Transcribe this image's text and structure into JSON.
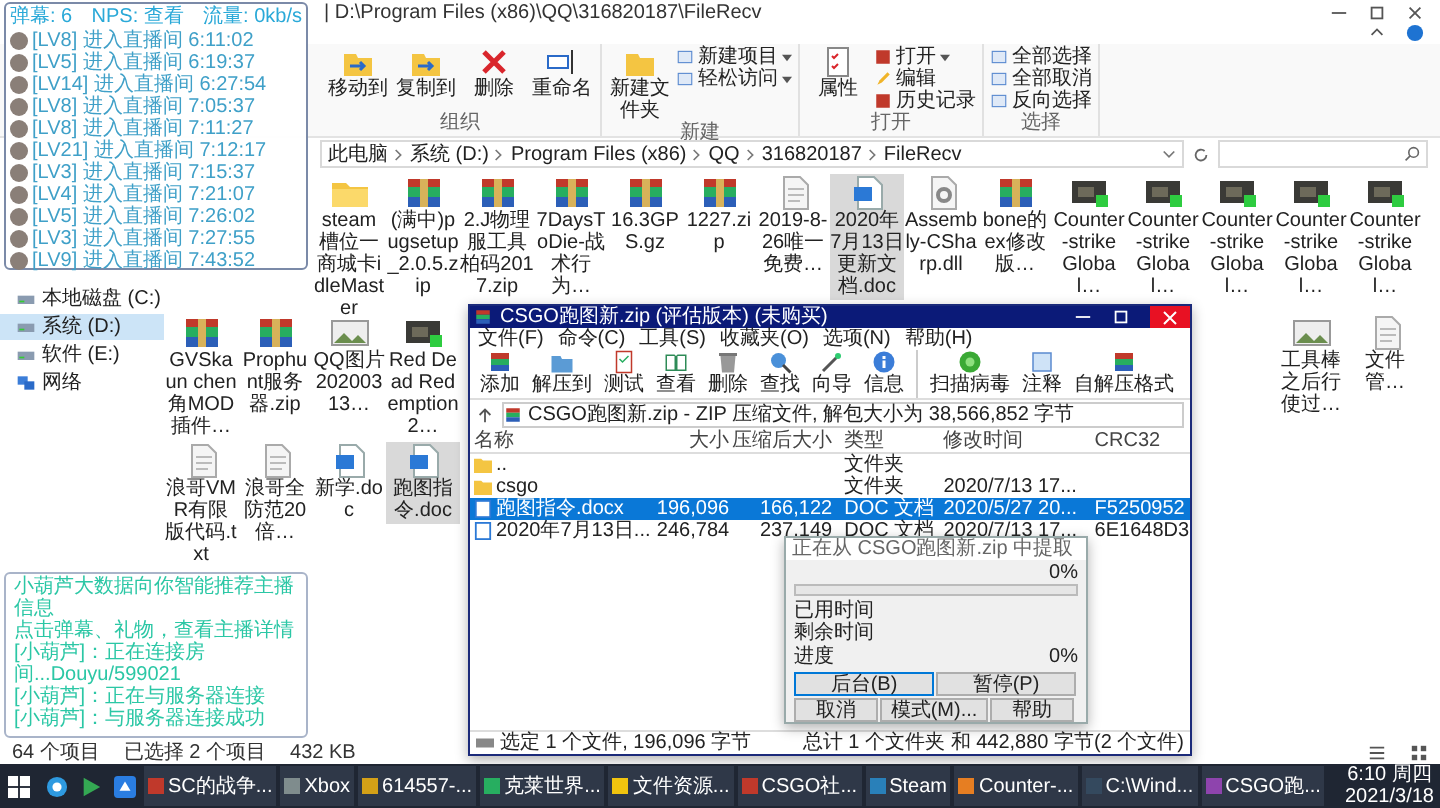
{
  "explorer": {
    "title": "| D:\\Program Files (x86)\\QQ\\316820187\\FileRecv",
    "ribbon_groups": [
      {
        "label": "组织",
        "large": [
          {
            "label": "移动到"
          },
          {
            "label": "复制到"
          },
          {
            "label": "删除"
          },
          {
            "label": "重命名"
          }
        ]
      },
      {
        "label": "新建",
        "large": [
          {
            "label": "新建文件夹"
          }
        ],
        "small": [
          {
            "label": "新建项目",
            "dropdown": true
          },
          {
            "label": "轻松访问",
            "dropdown": true
          }
        ]
      },
      {
        "label": "打开",
        "large": [
          {
            "label": "属性"
          }
        ],
        "small": [
          {
            "label": "打开",
            "dropdown": true
          },
          {
            "label": "编辑",
            "dropdown": false
          },
          {
            "label": "历史记录",
            "dropdown": false
          }
        ]
      },
      {
        "label": "选择",
        "small": [
          {
            "label": "全部选择",
            "dropdown": false
          },
          {
            "label": "全部取消",
            "dropdown": false
          },
          {
            "label": "反向选择",
            "dropdown": false
          }
        ]
      }
    ],
    "breadcrumb": [
      "此电脑",
      "系统 (D:)",
      "Program Files (x86)",
      "QQ",
      "316820187",
      "FileRecv"
    ],
    "nav_items": [
      {
        "label": "本地磁盘 (C:)",
        "kind": "drive",
        "selected": false
      },
      {
        "label": "系统 (D:)",
        "kind": "drive",
        "selected": true
      },
      {
        "label": "软件 (E:)",
        "kind": "drive",
        "selected": false
      },
      {
        "label": "网络",
        "kind": "network",
        "selected": false
      }
    ],
    "file_rows": [
      {
        "left": [
          {
            "name": "steam槽位一商城卡idleMaster",
            "kind": "folder",
            "selected": false
          },
          {
            "name": "(满中)pugsetup_2.0.5.zip",
            "kind": "archive",
            "selected": false
          },
          {
            "name": "2.J物理服工具柏码2017.zip",
            "kind": "archive",
            "selected": false
          },
          {
            "name": "7DaysToDie-战术行为…",
            "kind": "archive",
            "selected": false
          },
          {
            "name": "16.3GPS.gz",
            "kind": "archive",
            "selected": false
          },
          {
            "name": "1227.zip",
            "kind": "archive",
            "selected": false
          },
          {
            "name": "2019-8-26唯一免费…",
            "kind": "text",
            "selected": false
          },
          {
            "name": "2020年7月13日更新文档.doc",
            "kind": "doc",
            "selected": true
          },
          {
            "name": "Assembly-CSharp.dll",
            "kind": "dll",
            "selected": false
          },
          {
            "name": "bone的ex修改版…",
            "kind": "archive",
            "selected": false
          },
          {
            "name": "Counter-strike Global…",
            "kind": "video",
            "selected": false
          },
          {
            "name": "Counter-strike Global…",
            "kind": "video",
            "selected": false
          },
          {
            "name": "Counter-strike Global…",
            "kind": "video",
            "selected": false
          },
          {
            "name": "Counter-strike Global…",
            "kind": "video",
            "selected": false
          },
          {
            "name": "Counter-strike Global…",
            "kind": "video",
            "selected": false
          }
        ]
      },
      {
        "left": [
          {
            "name": "GVSkaun chen角MOD插件…",
            "kind": "archive",
            "selected": false
          },
          {
            "name": "Prophunt服务器.zip",
            "kind": "archive",
            "selected": false
          },
          {
            "name": "QQ图片20200313…",
            "kind": "image",
            "selected": false
          },
          {
            "name": "Red Dead Redemption 2…",
            "kind": "video",
            "selected": false
          }
        ],
        "right": [
          {
            "name": "工具棒之后行使过…",
            "kind": "image",
            "selected": false
          },
          {
            "name": "文件管…",
            "kind": "text",
            "selected": false
          }
        ]
      },
      {
        "left": [
          {
            "name": "浪哥VMR有限版代码.txt",
            "kind": "text",
            "selected": false
          },
          {
            "name": "浪哥全防范20倍…",
            "kind": "text",
            "selected": false
          },
          {
            "name": "新学.doc",
            "kind": "doc",
            "selected": false
          },
          {
            "name": "跑图指令.doc",
            "kind": "doc",
            "selected": true
          }
        ]
      }
    ],
    "status": [
      "64 个项目",
      "已选择 2 个项目",
      "432 KB"
    ]
  },
  "overlay": {
    "stats": [
      "弹幕: 6",
      "NPS: 查看",
      "流量: 0kb/s"
    ],
    "chat": [
      "[LV8] 进入直播间 6:11:02",
      "[LV5] 进入直播间 6:19:37",
      "[LV14] 进入直播间 6:27:54",
      "[LV8] 进入直播间 7:05:37",
      "[LV8] 进入直播间 7:11:27",
      "[LV21] 进入直播间 7:12:17",
      "[LV3] 进入直播间 7:15:37",
      "[LV4] 进入直播间 7:21:07",
      "[LV5] 进入直播间 7:26:02",
      "[LV3] 进入直播间 7:27:55",
      "[LV9] 进入直播间 7:43:52"
    ],
    "messages": [
      "小葫芦大数据向你智能推荐主播信息",
      "点击弹幕、礼物，查看主播详情",
      "[小葫芦]：正在连接房间...Douyu/599021",
      "[小葫芦]：正在与服务器连接",
      "[小葫芦]：与服务器连接成功"
    ]
  },
  "winrar": {
    "title": "CSGO跑图新.zip (评估版本) (未购买)",
    "menu": [
      "文件(F)",
      "命令(C)",
      "工具(S)",
      "收藏夹(O)",
      "选项(N)",
      "帮助(H)"
    ],
    "tools": [
      "添加",
      "解压到",
      "测试",
      "查看",
      "删除",
      "查找",
      "向导",
      "信息",
      "扫描病毒",
      "注释",
      "自解压格式"
    ],
    "path": "CSGO跑图新.zip - ZIP 压缩文件, 解包大小为 38,566,852 字节",
    "columns": [
      "名称",
      "大小",
      "压缩后大小",
      "类型",
      "修改时间",
      "CRC32"
    ],
    "rows": [
      {
        "name": "..",
        "kind": "folder",
        "type": "文件夹",
        "selected": false
      },
      {
        "name": "csgo",
        "kind": "folder",
        "type": "文件夹",
        "modified": "2020/7/13 17...",
        "selected": false
      },
      {
        "name": "跑图指令.docx",
        "kind": "doc",
        "size": "196,096",
        "packed": "166,122",
        "type": "DOC 文档",
        "modified": "2020/5/27 20...",
        "crc": "F5250952",
        "selected": true
      },
      {
        "name": "2020年7月13日...",
        "kind": "doc",
        "size": "246,784",
        "packed": "237,149",
        "type": "DOC 文档",
        "modified": "2020/7/13 17...",
        "crc": "6E1648D3",
        "selected": false
      }
    ],
    "status": [
      "选定 1 个文件, 196,096 字节",
      "总计 1 个文件夹 和 442,880 字节(2 个文件)"
    ]
  },
  "extract_dialog": {
    "title": "正在从 CSGO跑图新.zip 中提取",
    "percent": "0%",
    "level": 0,
    "times": [
      "已用时间",
      "剩余时间"
    ],
    "progress_label": "进度",
    "progress_value": "0%",
    "buttons": [
      {
        "label": "后台(B)",
        "focused": true
      },
      {
        "label": "暂停(P)",
        "focused": false
      },
      {
        "label": "取消",
        "focused": false
      },
      {
        "label": "模式(M)...",
        "focused": false
      },
      {
        "label": "帮助",
        "focused": false
      }
    ]
  },
  "taskbar": {
    "tasks": [
      {
        "label": "SC的战争...",
        "color": "#c0392b"
      },
      {
        "label": "Xbox",
        "color": "#7f8c8d"
      },
      {
        "label": "614557-...",
        "color": "#d4a017"
      },
      {
        "label": "克莱世界...",
        "color": "#27ae60"
      },
      {
        "label": "文件资源...",
        "color": "#f1c40f"
      },
      {
        "label": "CSGO社...",
        "color": "#c0392b"
      },
      {
        "label": "Steam",
        "color": "#2980b9"
      },
      {
        "label": "Counter-...",
        "color": "#e67e22"
      },
      {
        "label": "C:\\Wind...",
        "color": "#34495e"
      },
      {
        "label": "CSGO跑...",
        "color": "#8e44ad"
      }
    ],
    "clock": [
      "6:10 周四",
      "2021/3/18"
    ]
  }
}
